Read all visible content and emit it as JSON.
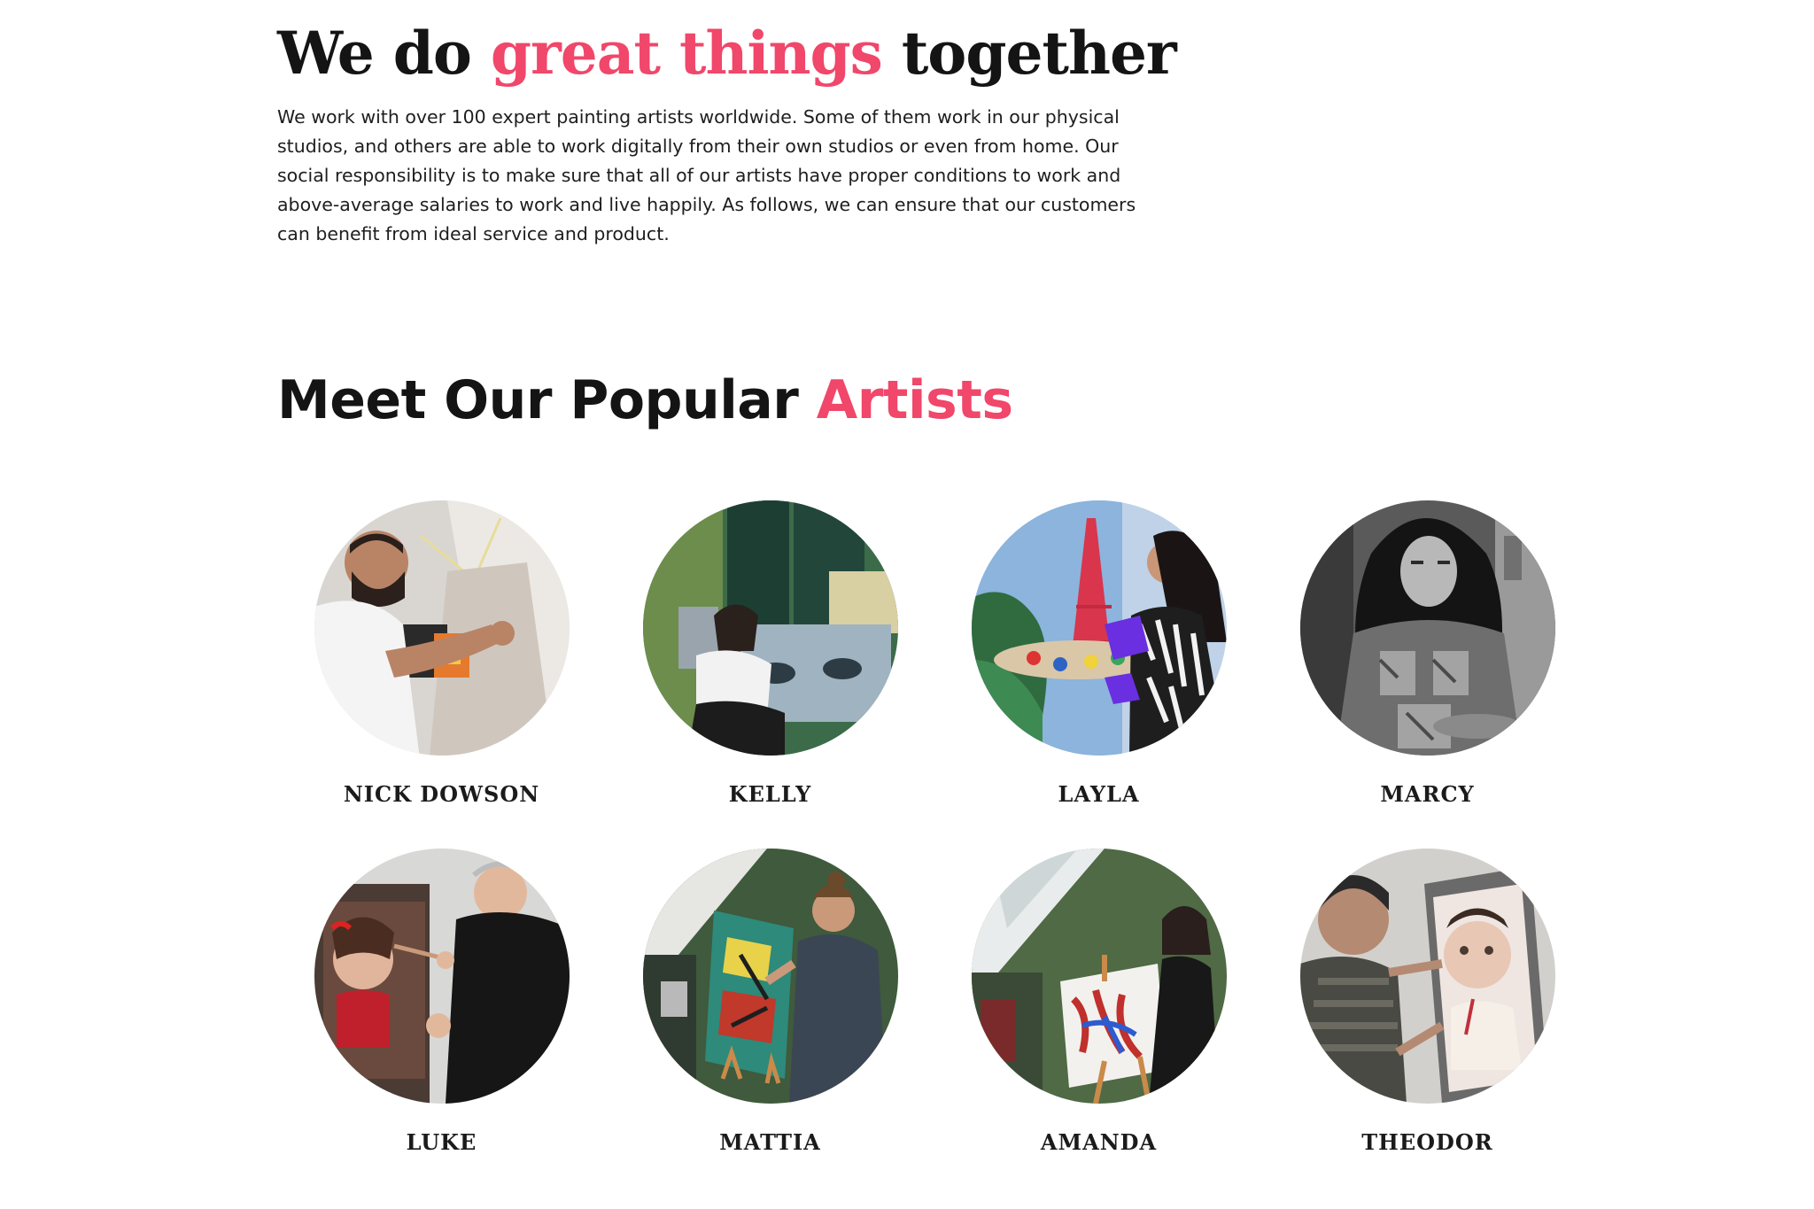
{
  "intro": {
    "title_before": "We do ",
    "title_highlight": "great things",
    "title_after": " together",
    "body": "We work with over 100 expert painting artists worldwide. Some of them work in our physical studios, and others are able to work digitally from their own studios or even from home. Our social responsibility is to make sure that all of our artists have proper conditions to work and above-average salaries to work and live happily. As follows, we can ensure that our customers can benefit from ideal service and product."
  },
  "artists_section": {
    "title_before": "Meet Our Popular ",
    "title_highlight": "Artists"
  },
  "colors": {
    "accent": "#f0476a",
    "heading": "#141414",
    "text": "#1e1e1e"
  },
  "artists": [
    {
      "name": "NICK DOWSON"
    },
    {
      "name": "KELLY"
    },
    {
      "name": "LAYLA"
    },
    {
      "name": "MARCY"
    },
    {
      "name": "LUKE"
    },
    {
      "name": "MATTIA"
    },
    {
      "name": "AMANDA"
    },
    {
      "name": "THEODOR"
    }
  ]
}
